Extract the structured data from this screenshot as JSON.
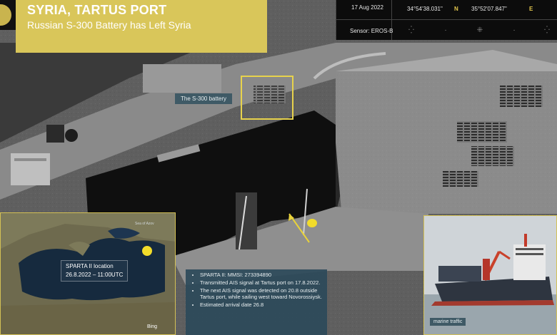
{
  "header": {
    "title": "SYRIA, TARTUS PORT",
    "subtitle": "Russian S-300 Battery has Left Syria"
  },
  "info_bar": {
    "date": "17 Aug 2022",
    "lat_value": "34°54'38.031\"",
    "lat_dir": "N",
    "lon_value": "35°52'07.847\"",
    "lon_dir": "E",
    "sensor": "Sensor: EROS-B"
  },
  "annotations": {
    "battery_label": "The S-300 battery"
  },
  "map_inset": {
    "sea_label": "Sea of Azov",
    "location_line1": "SPARTA II location",
    "location_line2": "26.8.2022 – 11:00UTC",
    "attribution": "Bing"
  },
  "info_panel": {
    "items": [
      "SPARTA II: MMSI: 273394890",
      "Transmitted AIS signal at Tartus port on 17.8.2022.",
      "The next AIS signal was detected on 20.8 outside Tartus port, while sailing west toward Novorossiysk.",
      "Estimated arrival date 26.8"
    ]
  },
  "ship_inset": {
    "caption": "marine traffic"
  },
  "colors": {
    "accent_yellow": "#d9c65a",
    "panel_blue": "#2c4a5a"
  }
}
